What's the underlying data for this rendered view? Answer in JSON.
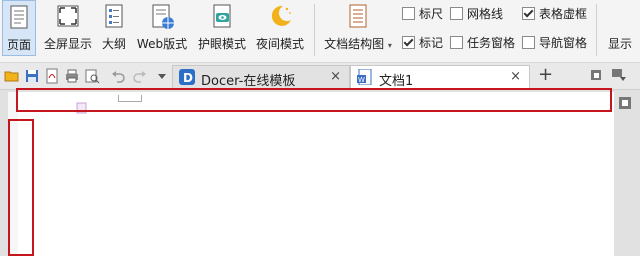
{
  "ribbon": {
    "buttons": [
      {
        "label": "页面",
        "icon": "page-view-icon",
        "active": true
      },
      {
        "label": "全屏显示",
        "icon": "fullscreen-icon"
      },
      {
        "label": "大纲",
        "icon": "outline-icon"
      },
      {
        "label": "Web版式",
        "icon": "web-layout-icon"
      },
      {
        "label": "护眼模式",
        "icon": "eye-care-icon"
      },
      {
        "label": "夜间模式",
        "icon": "night-mode-icon"
      },
      {
        "label": "文档结构图",
        "icon": "document-map-icon"
      }
    ],
    "checkboxes": [
      {
        "label": "标尺",
        "checked": false
      },
      {
        "label": "网格线",
        "checked": false
      },
      {
        "label": "表格虚框",
        "checked": true
      },
      {
        "label": "标记",
        "checked": true
      },
      {
        "label": "任务窗格",
        "checked": false
      },
      {
        "label": "导航窗格",
        "checked": false
      }
    ],
    "overflow_label": "显示"
  },
  "tabs": [
    {
      "label": "Docer-在线模板",
      "close": "×"
    },
    {
      "label": "文档1",
      "close": "×"
    }
  ],
  "new_tab_label": "+",
  "colors": {
    "highlight": "#c4161c",
    "active_tab": "#ffffff",
    "ribbon_bg": "#f4f4f4"
  }
}
